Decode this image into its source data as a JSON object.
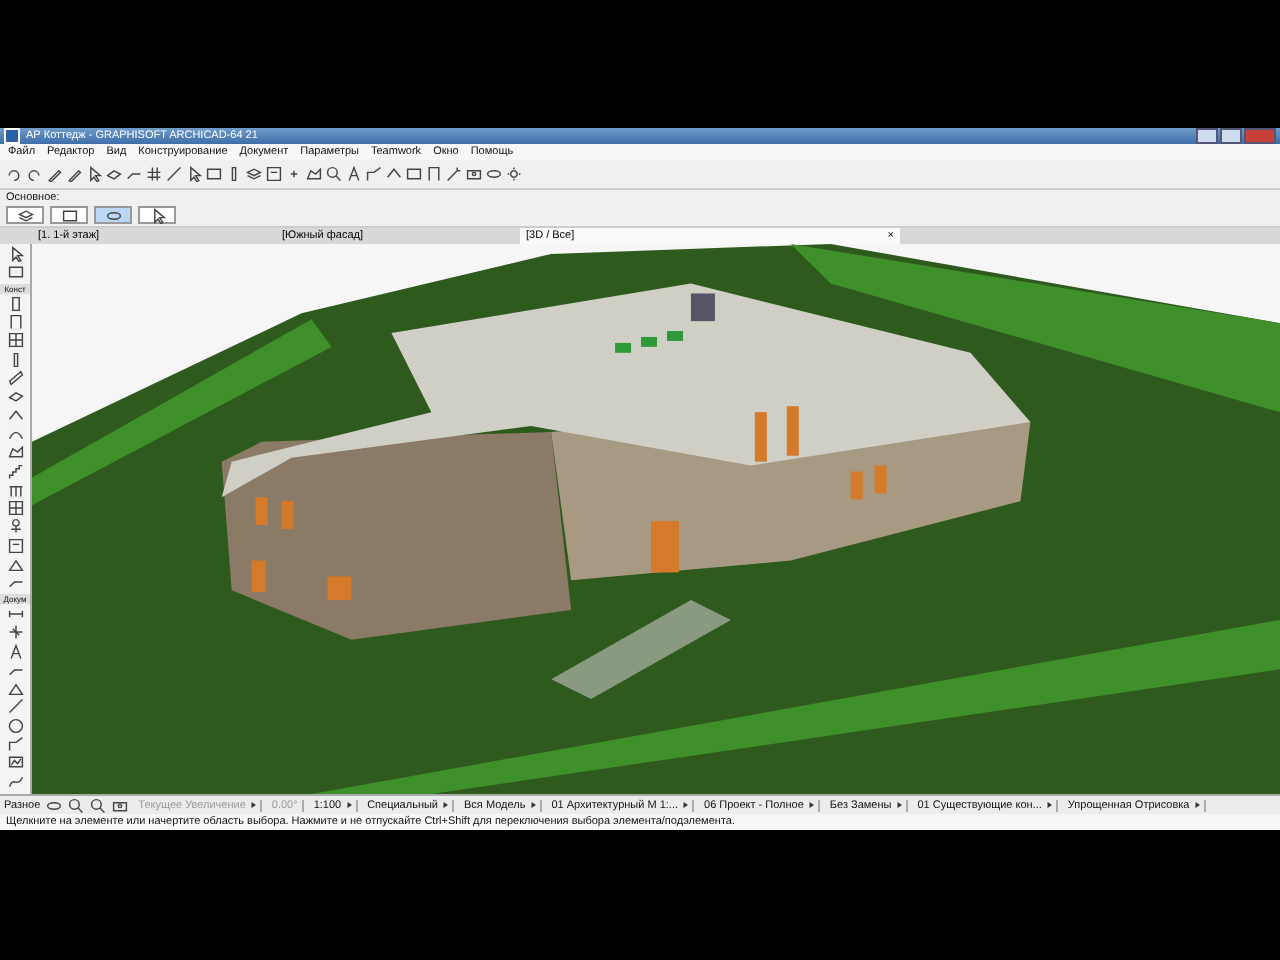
{
  "window": {
    "title": "АР Коттедж - GRAPHISOFT ARCHICAD-64 21"
  },
  "menu": [
    "Файл",
    "Редактор",
    "Вид",
    "Конструирование",
    "Документ",
    "Параметры",
    "Teamwork",
    "Окно",
    "Помощь"
  ],
  "info_box": {
    "label": "Основное:",
    "selection_on": true
  },
  "tabs": [
    {
      "label": "[1. 1-й этаж]",
      "selected": false
    },
    {
      "label": "[Южный фасад]",
      "selected": false
    },
    {
      "label": "[3D / Все]",
      "selected": true
    }
  ],
  "tab_close": "×",
  "toolbox": {
    "sections": [
      "Конст",
      "Докум"
    ]
  },
  "nav_bar": {
    "label": "Разное",
    "items": [
      {
        "text": "Текущее Увеличение",
        "kind": "dropdown",
        "disabled": true
      },
      {
        "text": "0.00°",
        "kind": "field",
        "disabled": true
      },
      {
        "text": "1:100",
        "kind": "dropdown",
        "disabled": false
      },
      {
        "text": "Специальный",
        "kind": "dropdown",
        "disabled": false
      },
      {
        "text": "Вся Модель",
        "kind": "dropdown",
        "disabled": false
      },
      {
        "text": "01 Архитектурный М 1:...",
        "kind": "dropdown",
        "disabled": false
      },
      {
        "text": "06 Проект - Полное",
        "kind": "dropdown",
        "disabled": false
      },
      {
        "text": "Без Замены",
        "kind": "dropdown",
        "disabled": false
      },
      {
        "text": "01 Существующие кон...",
        "kind": "dropdown",
        "disabled": false
      },
      {
        "text": "Упрощенная Отрисовка",
        "kind": "dropdown",
        "disabled": false
      }
    ]
  },
  "status_bar": {
    "message": "Щелкните на элементе или начертите область выбора. Нажмите и не отпускайте Ctrl+Shift для переключения выбора элемента/подэлемента."
  }
}
